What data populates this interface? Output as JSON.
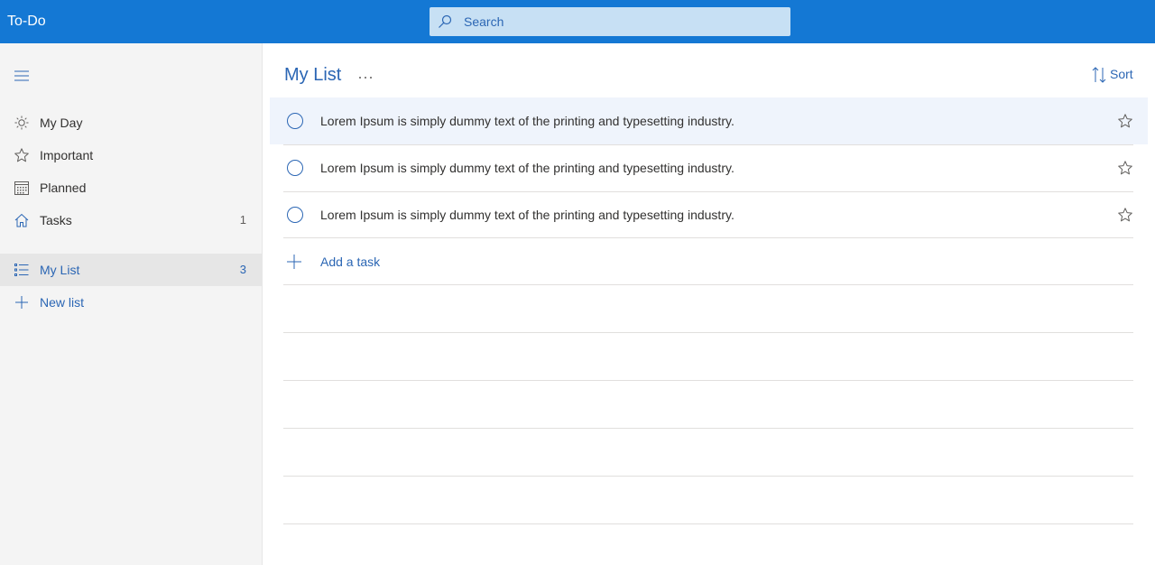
{
  "app": {
    "title": "To-Do"
  },
  "search": {
    "placeholder": "Search"
  },
  "sidebar": {
    "items": [
      {
        "label": "My Day",
        "icon": "sun-icon",
        "count": ""
      },
      {
        "label": "Important",
        "icon": "star-icon",
        "count": ""
      },
      {
        "label": "Planned",
        "icon": "calendar-icon",
        "count": ""
      },
      {
        "label": "Tasks",
        "icon": "home-icon",
        "count": "1"
      }
    ],
    "lists": [
      {
        "label": "My List",
        "icon": "list-icon",
        "count": "3",
        "selected": true
      }
    ],
    "new_list_label": "New list"
  },
  "main": {
    "title": "My List",
    "more_label": "···",
    "sort_label": "Sort",
    "tasks": [
      {
        "text": "Lorem Ipsum is simply dummy text of the printing and typesetting industry.",
        "important": false
      },
      {
        "text": "Lorem Ipsum is simply dummy text of the printing and typesetting industry.",
        "important": false
      },
      {
        "text": "Lorem Ipsum is simply dummy text of the printing and typesetting industry.",
        "important": false
      }
    ],
    "add_task_label": "Add a task"
  },
  "colors": {
    "accent": "#1478d4",
    "link": "#2b66b4",
    "sidebar_bg": "#f4f4f4"
  }
}
